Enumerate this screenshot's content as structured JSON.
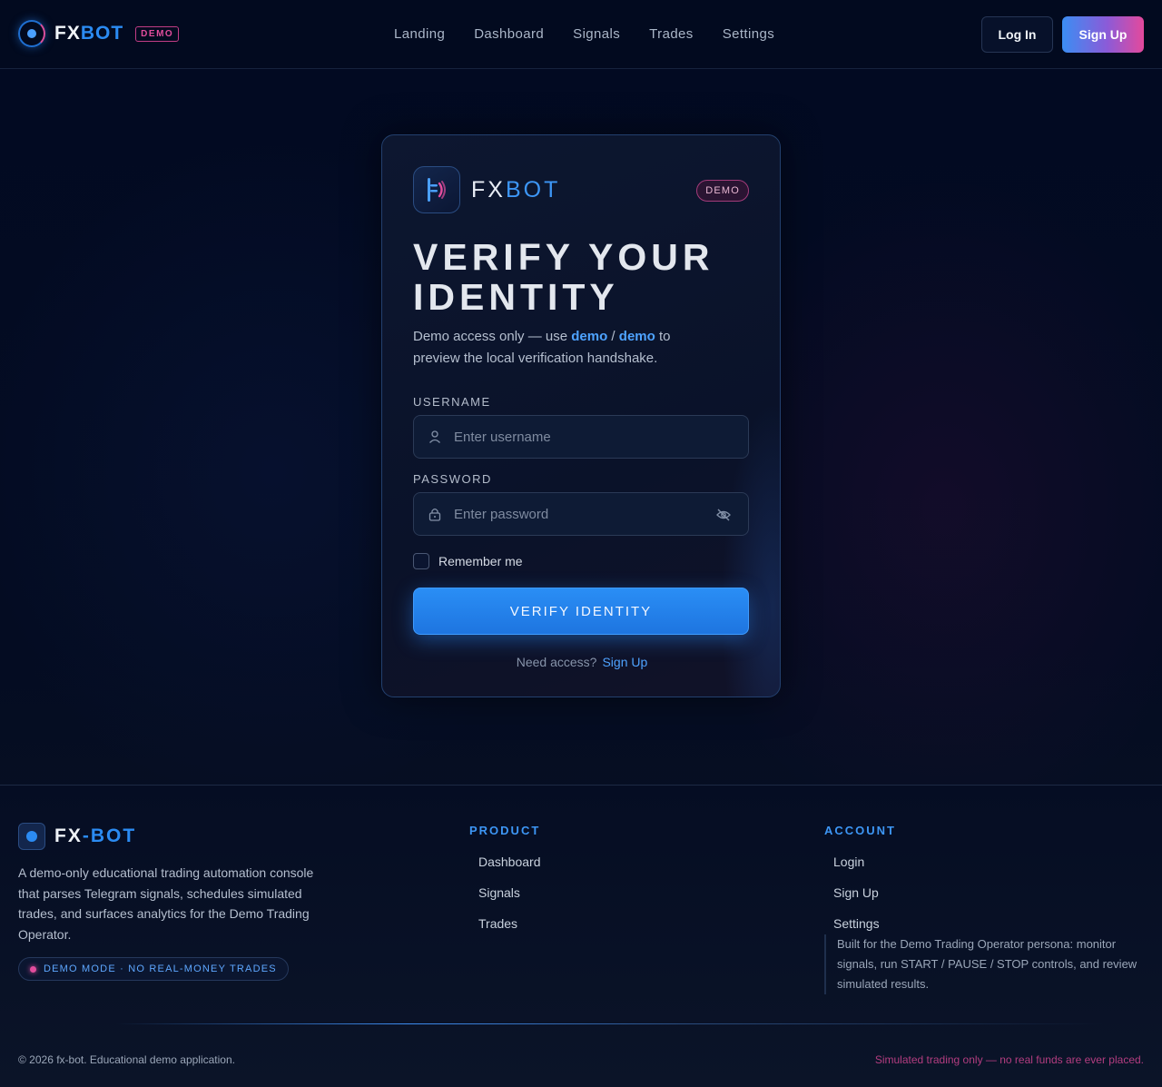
{
  "header": {
    "brand_fx": "FX",
    "brand_bot": "BOT",
    "brand_badge": "DEMO",
    "nav": [
      "Landing",
      "Dashboard",
      "Signals",
      "Trades",
      "Settings"
    ],
    "login_label": "Log In",
    "signup_label": "Sign Up"
  },
  "card": {
    "brand_fx": "FX",
    "brand_bot": "BOT",
    "badge": "DEMO",
    "title_line1": "VERIFY YOUR",
    "title_line2": "IDENTITY",
    "desc_pre": "Demo access only — use ",
    "desc_user": "demo",
    "desc_sep": " / ",
    "desc_pass": "demo",
    "desc_post": " to preview the local verification handshake.",
    "username_label": "USERNAME",
    "username_placeholder": "Enter username",
    "password_label": "PASSWORD",
    "password_placeholder": "Enter password",
    "remember_label": "Remember me",
    "verify_label": "VERIFY IDENTITY",
    "need_access": "Need access?",
    "signup_link": "Sign Up"
  },
  "footer": {
    "brand_fx": "FX",
    "brand_bot": "-BOT",
    "description": "A demo-only educational trading automation console that parses Telegram signals, schedules simulated trades, and surfaces analytics for the Demo Trading Operator.",
    "badge": "DEMO MODE · NO REAL-MONEY TRADES",
    "product_title": "PRODUCT",
    "product_links": [
      "Dashboard",
      "Signals",
      "Trades"
    ],
    "account_title": "ACCOUNT",
    "account_links": [
      "Login",
      "Sign Up",
      "Settings"
    ],
    "note": "Built for the Demo Trading Operator persona: monitor signals, run START / PAUSE / STOP controls, and review simulated results.",
    "copyright": "© 2026 fx-bot. Educational demo application.",
    "simulated": "Simulated trading only — no real funds are ever placed."
  },
  "colors": {
    "accent_blue": "#2b8bf2",
    "accent_pink": "#e24d9d",
    "background": "#030b1f"
  }
}
